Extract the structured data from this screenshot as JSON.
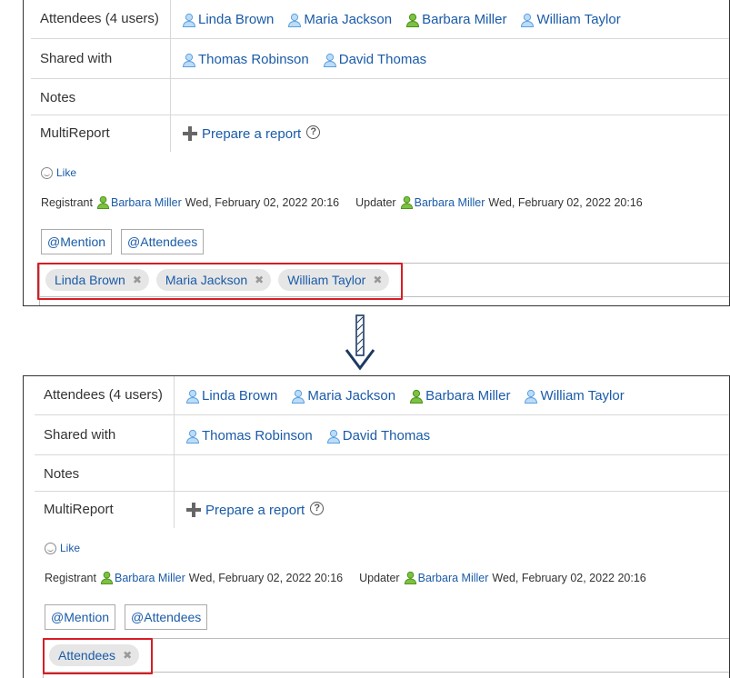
{
  "panels": [
    {
      "rows": {
        "attendees_label": "Attendees (4 users)",
        "attendees": [
          {
            "name": "Linda Brown",
            "icon": "person-blue-icon"
          },
          {
            "name": "Maria Jackson",
            "icon": "person-blue-icon"
          },
          {
            "name": "Barbara Miller",
            "icon": "person-green-icon"
          },
          {
            "name": "William Taylor",
            "icon": "person-blue-icon"
          }
        ],
        "shared_label": "Shared with",
        "shared": [
          {
            "name": "Thomas Robinson",
            "icon": "person-blue-icon"
          },
          {
            "name": "David Thomas",
            "icon": "person-blue-icon"
          }
        ],
        "notes_label": "Notes",
        "multireport_label": "MultiReport",
        "prepare_link": "Prepare a report"
      },
      "like": "Like",
      "meta": {
        "registrant_label": "Registrant",
        "registrant_name": "Barbara Miller",
        "registrant_time": "Wed, February 02, 2022 20:16",
        "updater_label": "Updater",
        "updater_name": "Barbara Miller",
        "updater_time": "Wed, February 02, 2022 20:16"
      },
      "buttons": {
        "mention": "@Mention",
        "attendees": "@Attendees"
      },
      "chips": [
        "Linda Brown",
        "Maria Jackson",
        "William Taylor"
      ]
    },
    {
      "rows": {
        "attendees_label": "Attendees (4 users)",
        "attendees": [
          {
            "name": "Linda Brown",
            "icon": "person-blue-icon"
          },
          {
            "name": "Maria Jackson",
            "icon": "person-blue-icon"
          },
          {
            "name": "Barbara Miller",
            "icon": "person-green-icon"
          },
          {
            "name": "William Taylor",
            "icon": "person-blue-icon"
          }
        ],
        "shared_label": "Shared with",
        "shared": [
          {
            "name": "Thomas Robinson",
            "icon": "person-blue-icon"
          },
          {
            "name": "David Thomas",
            "icon": "person-blue-icon"
          }
        ],
        "notes_label": "Notes",
        "multireport_label": "MultiReport",
        "prepare_link": "Prepare a report"
      },
      "like": "Like",
      "meta": {
        "registrant_label": "Registrant",
        "registrant_name": "Barbara Miller",
        "registrant_time": "Wed, February 02, 2022 20:16",
        "updater_label": "Updater",
        "updater_name": "Barbara Miller",
        "updater_time": "Wed, February 02, 2022 20:16"
      },
      "buttons": {
        "mention": "@Mention",
        "attendees": "@Attendees"
      },
      "chips": [
        "Attendees"
      ]
    }
  ],
  "colors": {
    "link": "#1a5ba8",
    "highlight": "#d91c24",
    "user_blue": "#5aa0e0",
    "user_green": "#5aa51e"
  }
}
